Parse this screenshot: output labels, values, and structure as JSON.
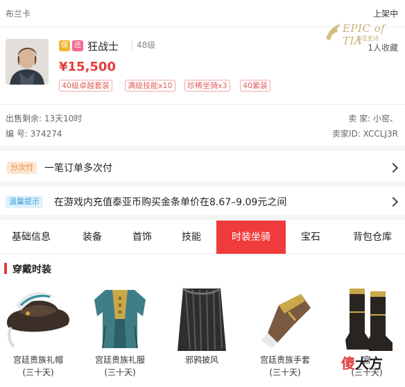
{
  "header": {
    "server": "布兰卡",
    "status": "上架中"
  },
  "logo": {
    "title": "EPIC of TIA",
    "subtitle": "泰亚史诗"
  },
  "favorites": "1人收藏",
  "character": {
    "badges": [
      "保",
      "还"
    ],
    "name": "狂战士",
    "level": "48级",
    "price": "¥15,500",
    "tags": [
      "40级卓越套装",
      "满级技能x10",
      "珍稀坐骑x3",
      "40紫装"
    ]
  },
  "meta": {
    "time_left": "出售剩余: 13天10时",
    "seller": "卖 家: 小窑、",
    "serial": "编 号: 374274",
    "seller_id": "卖家ID: XCCLJ3R"
  },
  "payment": {
    "label": "分次付",
    "text": "一笔订单多次付"
  },
  "tip": {
    "label": "温馨提示",
    "text": "在游戏内充值泰亚币购买金条单价在8.67–9.09元之间"
  },
  "tabs": [
    "基础信息",
    "装备",
    "首饰",
    "技能",
    "时装坐骑",
    "宝石",
    "背包仓库"
  ],
  "active_tab": "时装坐骑",
  "section": {
    "title": "穿戴时装"
  },
  "items": [
    {
      "name": "宫廷贵族礼帽",
      "duration": "(三十天)"
    },
    {
      "name": "宫廷贵族礼服",
      "duration": "(三十天)"
    },
    {
      "name": "邪鸦披风",
      "duration": ""
    },
    {
      "name": "宫廷贵族手套",
      "duration": "(三十天)"
    },
    {
      "name": "宫",
      "duration": "(三十天)"
    }
  ],
  "watermark": {
    "part1": "傻",
    "part2": "大方"
  },
  "colors": {
    "accent": "#ef3b3b",
    "price": "#e23c3c",
    "tag_border": "#f0a6a6"
  }
}
